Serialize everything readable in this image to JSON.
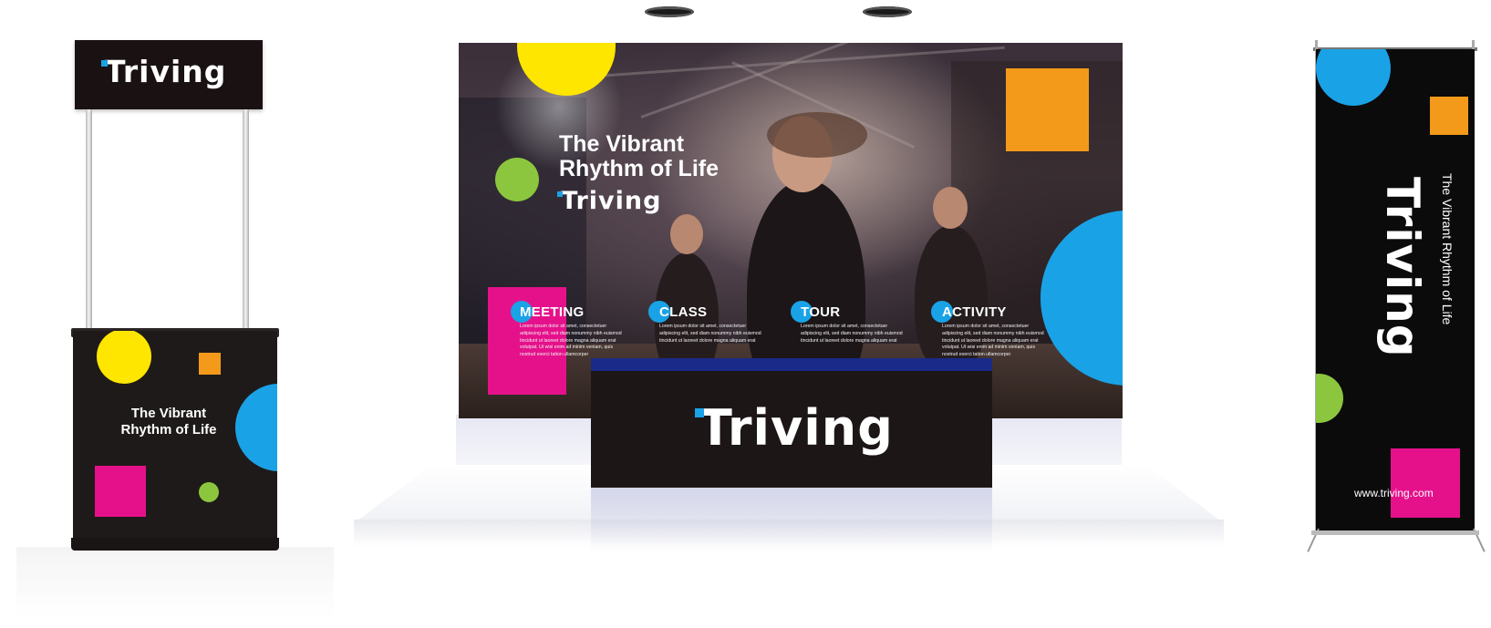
{
  "brand": {
    "name": "Triving",
    "tagline_line1": "The Vibrant",
    "tagline_line2": "Rhythm of Life",
    "tagline_full": "The Vibrant Rhythm of Life",
    "website": "www.triving.com"
  },
  "colors": {
    "yellow": "#ffe600",
    "blue": "#1aa2e6",
    "green": "#8cc63e",
    "magenta": "#e5118b",
    "orange": "#f39a1a",
    "black": "#1a1414"
  },
  "sections": [
    {
      "title": "MEETING",
      "body": "Lorem ipsum dolor sit amet, consectetuer adipiscing elit, sed diam nonummy nibh euismod tincidunt ut laoreet dolore magna aliquam erat volutpat. Ut wisi enim ad minim veniam, quis nostrud exerci tation ullamcorper"
    },
    {
      "title": "CLASS",
      "body": "Lorem ipsum dolor sit amet, consectetuer adipiscing elit, sed diam nonummy nibh euismod tincidunt ut laoreet dolore magna aliquam erat"
    },
    {
      "title": "TOUR",
      "body": "Lorem ipsum dolor sit amet, consectetuer adipiscing elit, sed diam nonummy nibh euismod tincidunt ut laoreet dolore magna aliquam erat"
    },
    {
      "title": "ACTIVITY",
      "body": "Lorem ipsum dolor sit amet, consectetuer adipiscing elit, sed diam nonummy nibh euismod tincidunt ut laoreet dolore magna aliquam erat volutpat. Ut wisi enim ad minim veniam, quis nostrud exerci tation ullamcorper"
    }
  ]
}
